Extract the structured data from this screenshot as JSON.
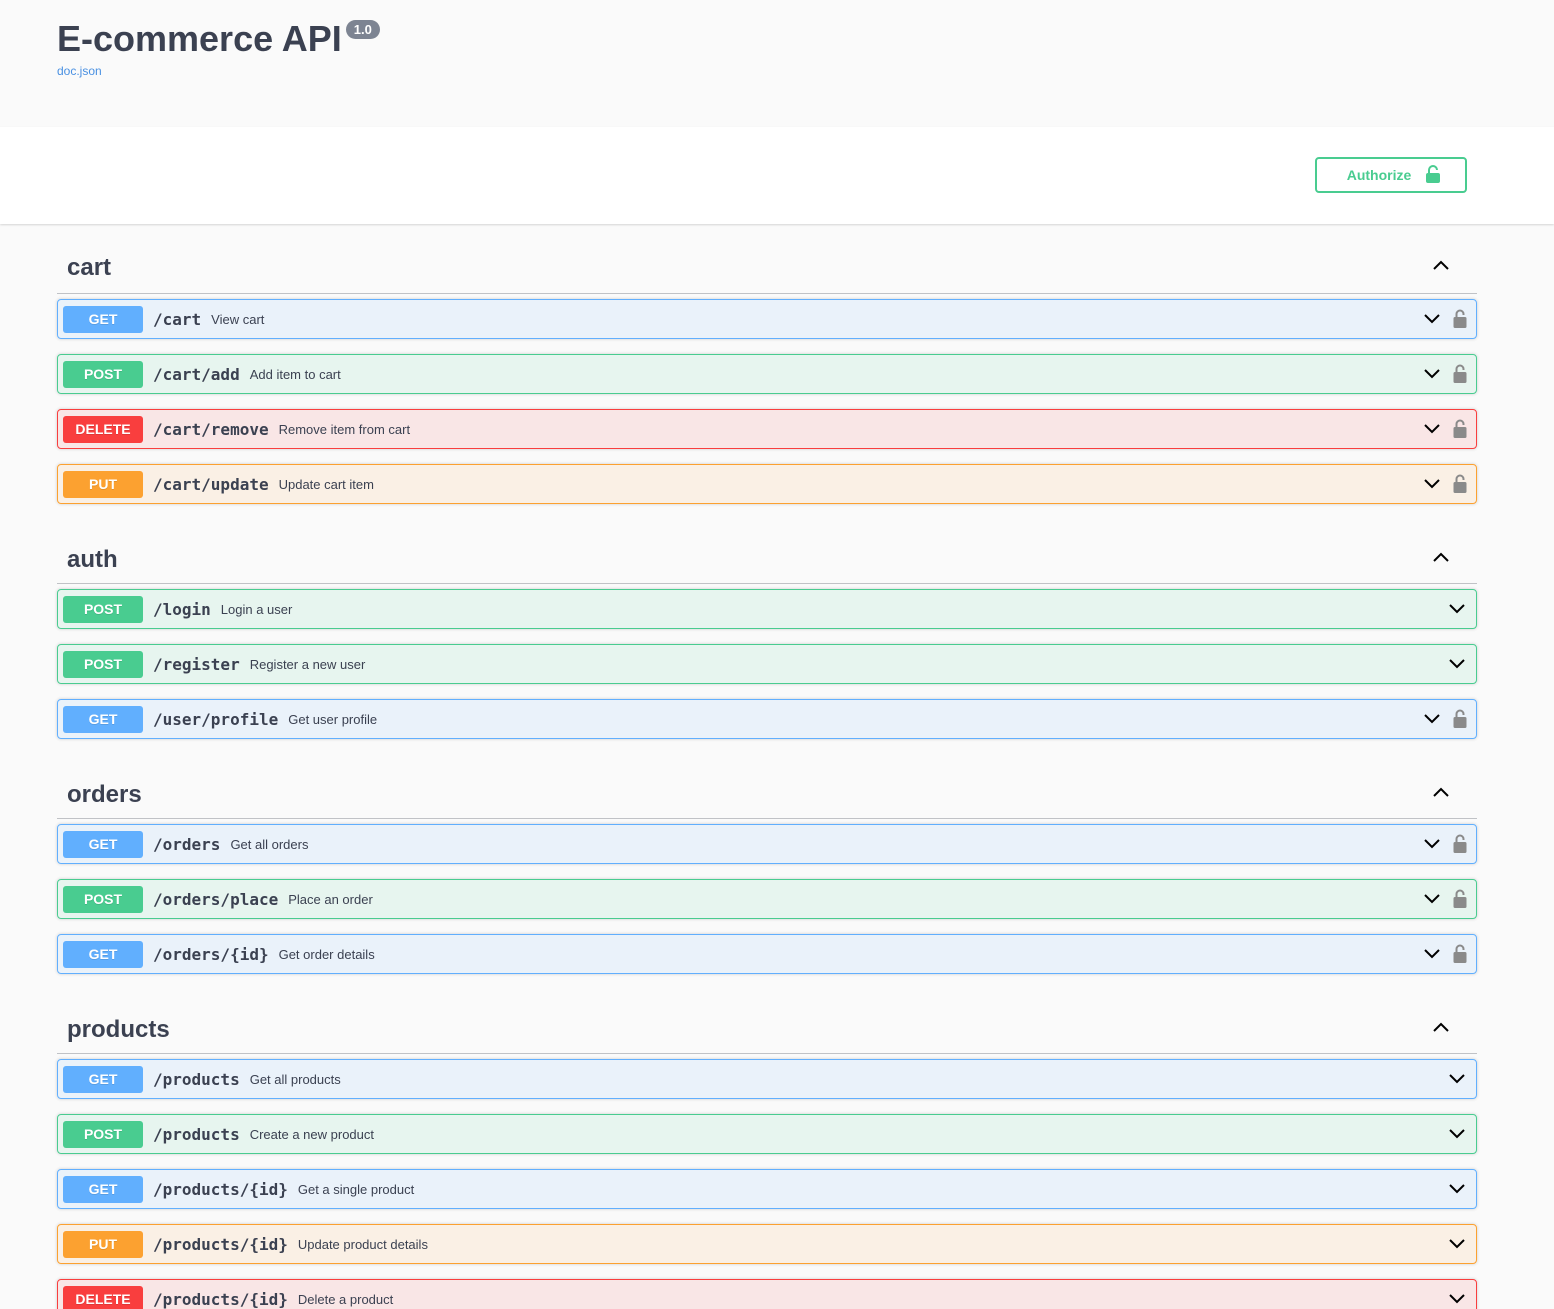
{
  "info": {
    "title": "E-commerce API",
    "version": "1.0",
    "doc_link": "doc.json"
  },
  "scheme": {
    "authorize_label": "Authorize",
    "authorize_icon": "unlock-icon",
    "accent": "#49cc90"
  },
  "colors": {
    "get": "#61affe",
    "post": "#49cc90",
    "delete": "#f93e3e",
    "put": "#fca130"
  },
  "tags": [
    {
      "name": "cart",
      "operations": [
        {
          "method": "GET",
          "path": "/cart",
          "summary": "View cart",
          "locked": true
        },
        {
          "method": "POST",
          "path": "/cart/add",
          "summary": "Add item to cart",
          "locked": true
        },
        {
          "method": "DELETE",
          "path": "/cart/remove",
          "summary": "Remove item from cart",
          "locked": true
        },
        {
          "method": "PUT",
          "path": "/cart/update",
          "summary": "Update cart item",
          "locked": true
        }
      ]
    },
    {
      "name": "auth",
      "operations": [
        {
          "method": "POST",
          "path": "/login",
          "summary": "Login a user",
          "locked": false
        },
        {
          "method": "POST",
          "path": "/register",
          "summary": "Register a new user",
          "locked": false
        },
        {
          "method": "GET",
          "path": "/user/profile",
          "summary": "Get user profile",
          "locked": true
        }
      ]
    },
    {
      "name": "orders",
      "operations": [
        {
          "method": "GET",
          "path": "/orders",
          "summary": "Get all orders",
          "locked": true
        },
        {
          "method": "POST",
          "path": "/orders/place",
          "summary": "Place an order",
          "locked": true
        },
        {
          "method": "GET",
          "path": "/orders/{id}",
          "summary": "Get order details",
          "locked": true
        }
      ]
    },
    {
      "name": "products",
      "operations": [
        {
          "method": "GET",
          "path": "/products",
          "summary": "Get all products",
          "locked": false
        },
        {
          "method": "POST",
          "path": "/products",
          "summary": "Create a new product",
          "locked": false
        },
        {
          "method": "GET",
          "path": "/products/{id}",
          "summary": "Get a single product",
          "locked": false
        },
        {
          "method": "PUT",
          "path": "/products/{id}",
          "summary": "Update product details",
          "locked": false
        },
        {
          "method": "DELETE",
          "path": "/products/{id}",
          "summary": "Delete a product",
          "locked": false
        }
      ]
    }
  ]
}
